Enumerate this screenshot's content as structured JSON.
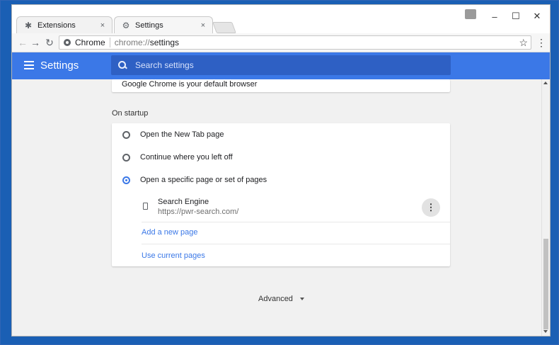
{
  "tabs": [
    {
      "label": "Extensions",
      "icon": "puzzle-icon"
    },
    {
      "label": "Settings",
      "icon": "gear-icon"
    }
  ],
  "tab_close_glyph": "×",
  "window_controls": {
    "minimize": "–",
    "maximize": "☐",
    "close": "✕"
  },
  "toolbar": {
    "back": "←",
    "forward": "→",
    "reload": "↻",
    "omnibox_chip_label": "Chrome",
    "url_scheme": "chrome://",
    "url_path": "settings",
    "star": "☆",
    "menu": "⋮"
  },
  "appbar": {
    "title": "Settings",
    "search_placeholder": "Search settings"
  },
  "default_browser_text": "Google Chrome is your default browser",
  "on_startup": {
    "title": "On startup",
    "options": [
      {
        "label": "Open the New Tab page",
        "checked": false
      },
      {
        "label": "Continue where you left off",
        "checked": false
      },
      {
        "label": "Open a specific page or set of pages",
        "checked": true
      }
    ],
    "page": {
      "name": "Search Engine",
      "url": "https://pwr-search.com/"
    },
    "more_glyph": "⋮",
    "add_page_label": "Add a new page",
    "use_current_label": "Use current pages"
  },
  "advanced_label": "Advanced",
  "colors": {
    "accent": "#3b78e7",
    "appbar": "#3b78e7",
    "search_bg": "#2e60c4",
    "content_bg": "#f1f1f1"
  }
}
